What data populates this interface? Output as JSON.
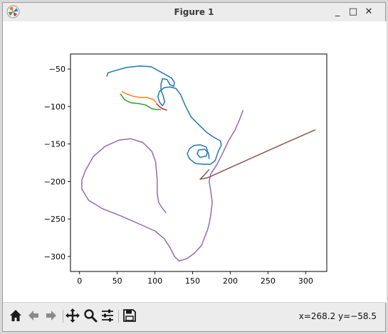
{
  "window": {
    "title": "Figure 1",
    "controls": {
      "minimize": "_",
      "maximize": "□",
      "close": "✕"
    }
  },
  "toolbar": {
    "buttons": [
      {
        "name": "home",
        "icon": "home-icon"
      },
      {
        "name": "back",
        "icon": "arrow-left-icon"
      },
      {
        "name": "forward",
        "icon": "arrow-right-icon"
      },
      {
        "name": "pan",
        "icon": "move-icon"
      },
      {
        "name": "zoom",
        "icon": "magnifier-icon"
      },
      {
        "name": "configure",
        "icon": "sliders-icon"
      },
      {
        "name": "save",
        "icon": "floppy-icon"
      }
    ],
    "coords": "x=268.2 y=−58.5"
  },
  "chart_data": {
    "type": "line",
    "xlim": [
      -12,
      328
    ],
    "ylim": [
      -320,
      -30
    ],
    "xticks": [
      0,
      50,
      100,
      150,
      200,
      250,
      300
    ],
    "yticks": [
      -50,
      -100,
      -150,
      -200,
      -250,
      -300
    ],
    "xtick_labels": [
      "0",
      "50",
      "100",
      "150",
      "200",
      "250",
      "300"
    ],
    "ytick_labels": [
      "−50",
      "−100",
      "−150",
      "−200",
      "−250",
      "−300"
    ],
    "grid": false,
    "series": [
      {
        "color": "#1f77b4",
        "points": [
          [
            36,
            -60
          ],
          [
            38,
            -55
          ],
          [
            48,
            -52
          ],
          [
            62,
            -48
          ],
          [
            80,
            -46
          ],
          [
            95,
            -47
          ],
          [
            106,
            -53
          ],
          [
            115,
            -58
          ],
          [
            122,
            -62
          ],
          [
            126,
            -68
          ],
          [
            125,
            -73
          ],
          [
            120,
            -71
          ],
          [
            116,
            -64
          ],
          [
            110,
            -63
          ],
          [
            108,
            -70
          ],
          [
            108,
            -78
          ],
          [
            111,
            -86
          ],
          [
            113,
            -94
          ],
          [
            110,
            -99
          ],
          [
            106,
            -94
          ],
          [
            104,
            -87
          ],
          [
            106,
            -80
          ],
          [
            112,
            -75
          ],
          [
            120,
            -74
          ],
          [
            128,
            -76
          ],
          [
            134,
            -84
          ],
          [
            140,
            -98
          ],
          [
            148,
            -114
          ],
          [
            158,
            -124
          ],
          [
            168,
            -134
          ],
          [
            178,
            -141
          ],
          [
            187,
            -146
          ],
          [
            188,
            -152
          ],
          [
            184,
            -160
          ],
          [
            180,
            -172
          ],
          [
            174,
            -177
          ],
          [
            164,
            -177
          ],
          [
            154,
            -176
          ],
          [
            146,
            -170
          ],
          [
            143,
            -163
          ],
          [
            146,
            -156
          ],
          [
            152,
            -152
          ],
          [
            160,
            -151
          ],
          [
            168,
            -154
          ],
          [
            170,
            -160
          ],
          [
            168,
            -166
          ],
          [
            160,
            -168
          ],
          [
            156,
            -163
          ],
          [
            158,
            -158
          ],
          [
            166,
            -157
          ],
          [
            171,
            -162
          ],
          [
            172,
            -170
          ]
        ]
      },
      {
        "color": "#ff7f0e",
        "points": [
          [
            56,
            -80
          ],
          [
            62,
            -83
          ],
          [
            70,
            -86
          ],
          [
            80,
            -88
          ],
          [
            90,
            -88
          ],
          [
            98,
            -91
          ],
          [
            102,
            -95
          ]
        ]
      },
      {
        "color": "#2ca02c",
        "points": [
          [
            54,
            -83
          ],
          [
            60,
            -91
          ],
          [
            68,
            -95
          ],
          [
            78,
            -96
          ],
          [
            88,
            -98
          ],
          [
            96,
            -103
          ],
          [
            102,
            -104
          ],
          [
            108,
            -104
          ]
        ]
      },
      {
        "color": "#d62728",
        "points": [
          [
            102,
            -96
          ],
          [
            106,
            -100
          ],
          [
            110,
            -103
          ],
          [
            116,
            -105
          ]
        ]
      },
      {
        "color": "#9467bd",
        "points": [
          [
            115,
            -242
          ],
          [
            110,
            -236
          ],
          [
            105,
            -228
          ],
          [
            103,
            -216
          ],
          [
            103,
            -198
          ],
          [
            101,
            -174
          ],
          [
            96,
            -160
          ],
          [
            84,
            -148
          ],
          [
            68,
            -143
          ],
          [
            52,
            -145
          ],
          [
            34,
            -153
          ],
          [
            18,
            -167
          ],
          [
            8,
            -185
          ],
          [
            3,
            -198
          ],
          [
            3,
            -210
          ],
          [
            12,
            -225
          ],
          [
            30,
            -236
          ],
          [
            55,
            -246
          ],
          [
            80,
            -257
          ],
          [
            100,
            -266
          ],
          [
            112,
            -276
          ],
          [
            120,
            -288
          ],
          [
            126,
            -300
          ],
          [
            132,
            -306
          ],
          [
            142,
            -303
          ],
          [
            152,
            -296
          ],
          [
            162,
            -285
          ],
          [
            170,
            -264
          ],
          [
            172,
            -256
          ],
          [
            174,
            -246
          ],
          [
            176,
            -228
          ],
          [
            174,
            -212
          ],
          [
            172,
            -200
          ],
          [
            174,
            -190
          ],
          [
            182,
            -178
          ],
          [
            190,
            -162
          ],
          [
            198,
            -145
          ],
          [
            206,
            -132
          ],
          [
            212,
            -118
          ],
          [
            217,
            -105
          ]
        ]
      },
      {
        "color": "#8c564b",
        "points": [
          [
            172,
            -184
          ],
          [
            165,
            -192
          ],
          [
            160,
            -197
          ],
          [
            170,
            -195
          ],
          [
            190,
            -186
          ],
          [
            230,
            -168
          ],
          [
            270,
            -150
          ],
          [
            313,
            -131
          ]
        ]
      }
    ]
  }
}
